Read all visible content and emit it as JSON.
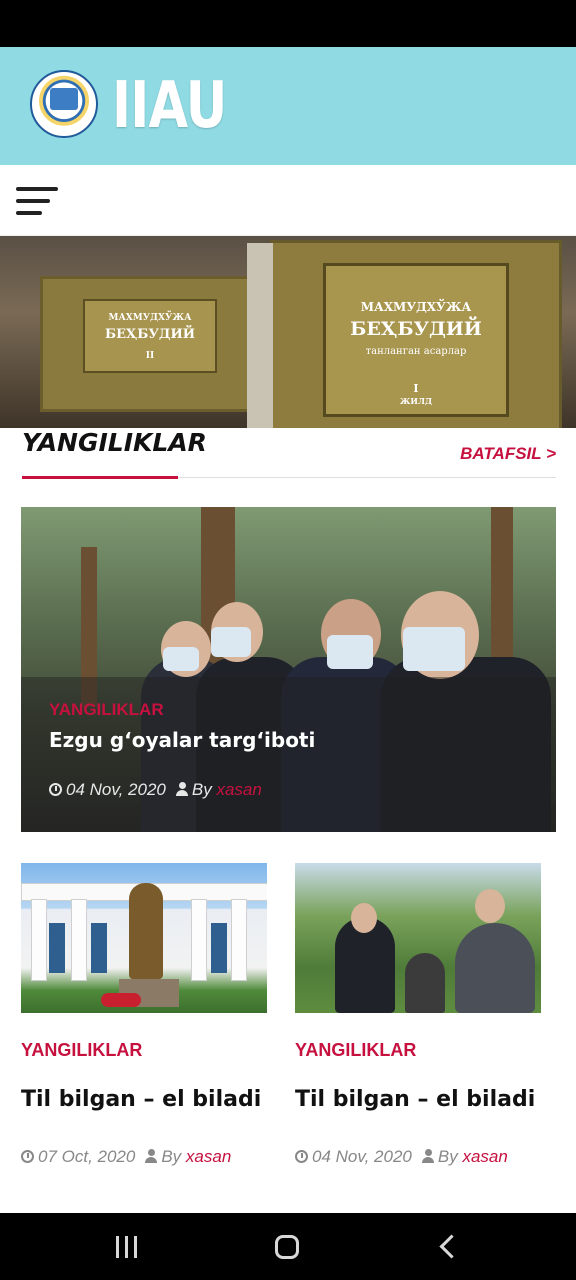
{
  "header": {
    "site_title": "IIAU",
    "accent_color": "#8fdae3"
  },
  "hero": {
    "book_small": {
      "line1": "МАХМУДХЎЖА",
      "line2": "БЕҲБУДИЙ",
      "volume": "II"
    },
    "book_large": {
      "line1": "МАХМУДХЎЖА",
      "line2": "БЕҲБУДИЙ",
      "subtitle": "танланган асарлар",
      "volume": "I",
      "volume_label": "ЖИЛД"
    }
  },
  "news_section": {
    "title": "YANGILIKLAR",
    "more_label": "BATAFSIL >",
    "accent_color": "#c6113f"
  },
  "featured": {
    "category": "YANGILIKLAR",
    "title": "Ezgu g‘oyalar targ‘iboti",
    "date": "04 Nov, 2020",
    "by": "By",
    "author": "xasan"
  },
  "cards": [
    {
      "category": "YANGILIKLAR",
      "title": "Til bilgan – el biladi",
      "date": "07 Oct, 2020",
      "by": "By",
      "author": "xasan"
    },
    {
      "category": "YANGILIKLAR",
      "title": "Til bilgan – el biladi",
      "date": "04 Nov, 2020",
      "by": "By",
      "author": "xasan"
    }
  ],
  "icons": {
    "menu": "hamburger-menu-icon",
    "date": "clock-icon",
    "author": "user-icon",
    "recents": "recents-icon",
    "home": "home-icon",
    "back": "back-icon"
  }
}
